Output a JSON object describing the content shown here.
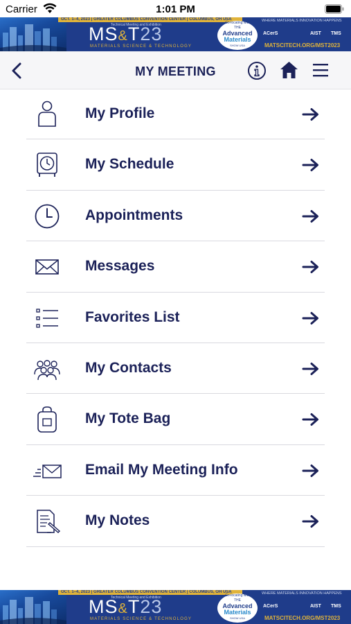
{
  "status_bar": {
    "carrier": "Carrier",
    "time": "1:01 PM"
  },
  "banner": {
    "dates": "OCT. 1–4, 2023  |  GREATER COLUMBUS CONVENTION CENTER  |  COLUMBUS, OH USA",
    "subtitle": "Technical Meeting and Exhibition",
    "logo_main": "MS",
    "logo_amp": "&",
    "logo_t": "T",
    "logo_year": "23",
    "logo_sub": "MATERIALS SCIENCE & TECHNOLOGY",
    "colocating": "Co-locating with",
    "the": "THE",
    "advanced": "Advanced",
    "materials": "Materials",
    "show": "SHOW USA",
    "tagline": "WHERE MATERIALS INNOVATION HAPPENS",
    "sponsor_1": "ACerS",
    "sponsor_2": "AIST",
    "sponsor_3": "TMS",
    "url": "MATSCITECH.ORG/MST2023"
  },
  "nav": {
    "title": "MY MEETING"
  },
  "menu": {
    "items": [
      {
        "label": "My Profile",
        "icon": "person-icon"
      },
      {
        "label": "My Schedule",
        "icon": "alarm-clock-icon"
      },
      {
        "label": "Appointments",
        "icon": "clock-icon"
      },
      {
        "label": "Messages",
        "icon": "envelope-icon"
      },
      {
        "label": "Favorites List",
        "icon": "checklist-icon"
      },
      {
        "label": "My Contacts",
        "icon": "people-group-icon"
      },
      {
        "label": "My Tote Bag",
        "icon": "tote-bag-icon"
      },
      {
        "label": "Email My Meeting Info",
        "icon": "send-mail-icon"
      },
      {
        "label": "My Notes",
        "icon": "notes-icon"
      }
    ]
  },
  "colors": {
    "primary": "#1b2158",
    "banner_blue": "#1f3c8a",
    "banner_gold": "#e0b33a",
    "nav_bg": "#f6f6f8",
    "divider": "#d9d9df"
  }
}
